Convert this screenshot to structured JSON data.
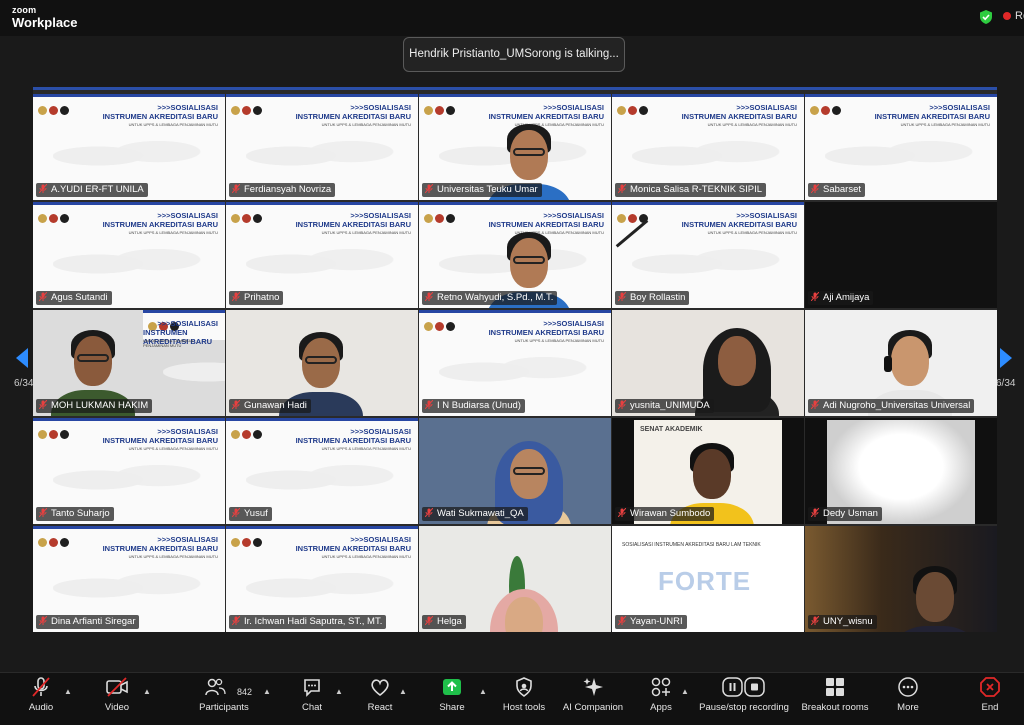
{
  "app": {
    "brand_top": "zoom",
    "brand_bottom": "Workplace",
    "recording_label": "Re"
  },
  "toast": {
    "text": "Hendrik Pristianto_UMSorong is talking..."
  },
  "pager": {
    "left": "6/34",
    "right": "6/34"
  },
  "slide": {
    "title1": ">>>SOSIALISASI",
    "title2": "INSTRUMEN AKREDITASI BARU",
    "subtitle": "UNTUK UPPS & LEMBAGA PENJAMINAN MUTU"
  },
  "participants": [
    "A.YUDI ER-FT UNILA",
    "Ferdiansyah Novriza",
    "Universitas Teuku Umar",
    "Monica Salisa R-TEKNIK SIPIL",
    "Sabarset",
    "Agus Sutandi",
    "Prihatno",
    "Retno Wahyudi, S.Pd., M.T.",
    "Boy Rollastin",
    "Aji Amijaya",
    "MOH LUKMAN HAKIM",
    "Gunawan Hadi",
    "I N Budiarsa (Unud)",
    "yusnita_UNIMUDA",
    "Adi Nugroho_Universitas Universal",
    "Tanto Suharjo",
    "Yusuf",
    "Wati Sukmawati_QA",
    "Wirawan Sumbodo",
    "Dedy Usman",
    "Dina Arfianti Siregar",
    "Ir. Ichwan Hadi Saputra, ST., MT.",
    "Helga",
    "Yayan-UNRI",
    "UNY_wisnu"
  ],
  "tile_extra": {
    "senat": "SENAT AKADEMIK",
    "forte_title": "SOSIALISASI INSTRUMEN AKREDITASI BARU LAM TEKNIK",
    "forte_logo": "FORTE"
  },
  "toolbar": {
    "audio": "Audio",
    "video": "Video",
    "participants": "Participants",
    "participants_count": "842",
    "chat": "Chat",
    "react": "React",
    "share": "Share",
    "host_tools": "Host tools",
    "ai": "AI Companion",
    "apps": "Apps",
    "record": "Pause/stop recording",
    "breakout": "Breakout rooms",
    "more": "More",
    "end": "End"
  },
  "colors": {
    "accent": "#2b4fa8",
    "share": "#1fbf4a",
    "end": "#e02828",
    "shield": "#2ecc40"
  }
}
